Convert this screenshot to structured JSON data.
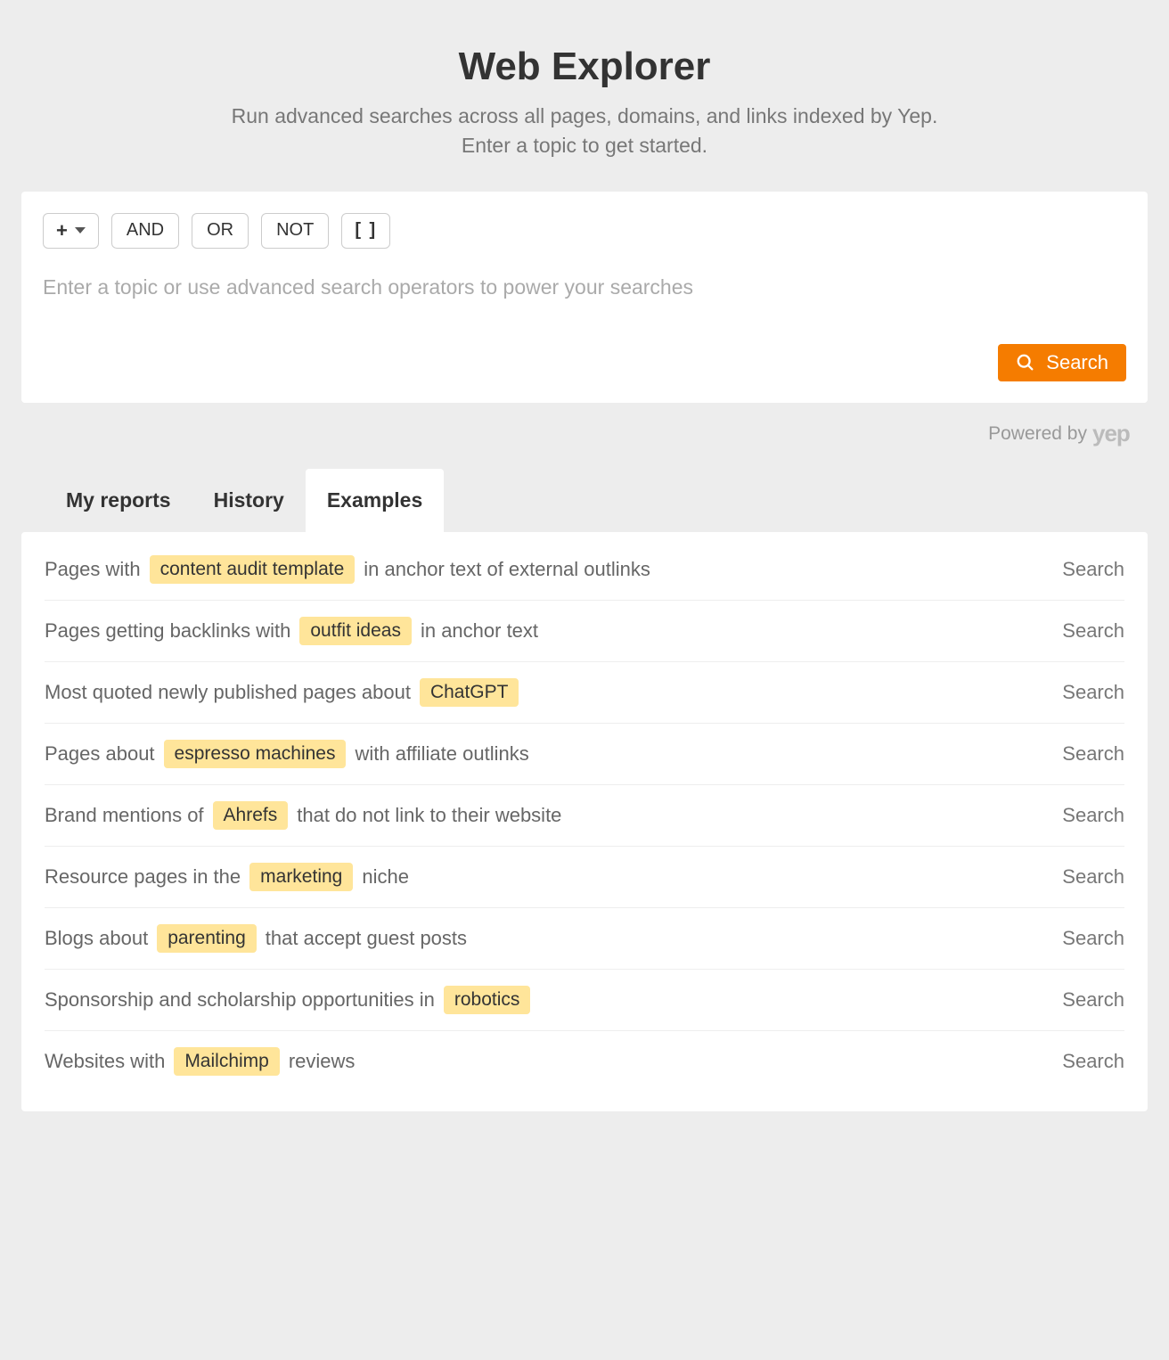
{
  "header": {
    "title": "Web Explorer",
    "subtitle_line1": "Run advanced searches across all pages, domains, and links indexed by Yep.",
    "subtitle_line2": "Enter a topic to get started."
  },
  "toolbar": {
    "add_label": "+",
    "and_label": "AND",
    "or_label": "OR",
    "not_label": "NOT",
    "brackets_label": "[ ]"
  },
  "search": {
    "placeholder": "Enter a topic or use advanced search operators to power your searches",
    "button_label": "Search"
  },
  "powered_by": {
    "label": "Powered by",
    "brand": "yep"
  },
  "tabs": {
    "my_reports": "My reports",
    "history": "History",
    "examples": "Examples",
    "active": "examples"
  },
  "examples": [
    {
      "pre": "Pages with",
      "highlight": "content audit template",
      "post": "in anchor text of external outlinks",
      "action": "Search"
    },
    {
      "pre": "Pages getting backlinks with",
      "highlight": "outfit ideas",
      "post": "in anchor text",
      "action": "Search"
    },
    {
      "pre": "Most quoted newly published pages about",
      "highlight": "ChatGPT",
      "post": "",
      "action": "Search"
    },
    {
      "pre": "Pages about",
      "highlight": "espresso machines",
      "post": "with affiliate outlinks",
      "action": "Search"
    },
    {
      "pre": "Brand mentions of",
      "highlight": "Ahrefs",
      "post": "that do not link to their website",
      "action": "Search"
    },
    {
      "pre": "Resource pages in the",
      "highlight": "marketing",
      "post": "niche",
      "action": "Search"
    },
    {
      "pre": "Blogs about",
      "highlight": "parenting",
      "post": "that accept guest posts",
      "action": "Search"
    },
    {
      "pre": "Sponsorship and scholarship opportunities in",
      "highlight": "robotics",
      "post": "",
      "action": "Search"
    },
    {
      "pre": "Websites with",
      "highlight": "Mailchimp",
      "post": "reviews",
      "action": "Search"
    }
  ]
}
